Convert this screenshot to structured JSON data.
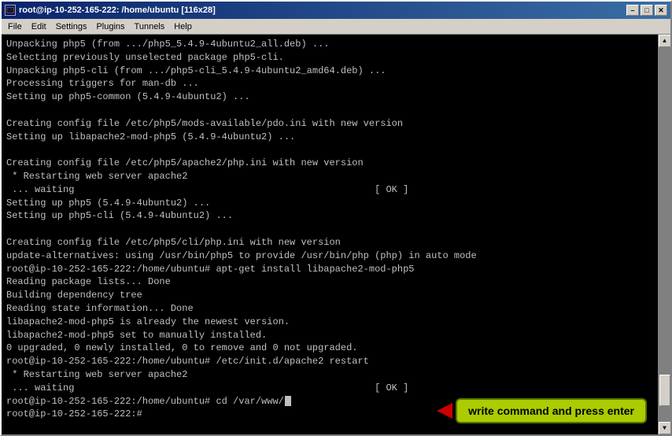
{
  "window": {
    "title": "root@ip-10-252-165-222: /home/ubuntu [116x28]",
    "min_label": "–",
    "max_label": "□",
    "close_label": "✕"
  },
  "menu": {
    "items": [
      "File",
      "Edit",
      "Settings",
      "Plugins",
      "Tunnels",
      "Help"
    ]
  },
  "terminal": {
    "lines": [
      "Unpacking php5 (from .../php5_5.4.9-4ubuntu2_all.deb) ...",
      "Selecting previously unselected package php5-cli.",
      "Unpacking php5-cli (from .../php5-cli_5.4.9-4ubuntu2_amd64.deb) ...",
      "Processing triggers for man-db ...",
      "Setting up php5-common (5.4.9-4ubuntu2) ...",
      "",
      "Creating config file /etc/php5/mods-available/pdo.ini with new version",
      "Setting up libapache2-mod-php5 (5.4.9-4ubuntu2) ...",
      "",
      "Creating config file /etc/php5/apache2/php.ini with new version",
      " * Restarting web server apache2",
      " ... waiting                                                     [ OK ]",
      "Setting up php5 (5.4.9-4ubuntu2) ...",
      "Setting up php5-cli (5.4.9-4ubuntu2) ...",
      "",
      "Creating config file /etc/php5/cli/php.ini with new version",
      "update-alternatives: using /usr/bin/php5 to provide /usr/bin/php (php) in auto mode",
      "root@ip-10-252-165-222:/home/ubuntu# apt-get install libapache2-mod-php5",
      "Reading package lists... Done",
      "Building dependency tree",
      "Reading state information... Done",
      "libapache2-mod-php5 is already the newest version.",
      "libapache2-mod-php5 set to manually installed.",
      "0 upgraded, 0 newly installed, 0 to remove and 0 not upgraded.",
      "root@ip-10-252-165-222:/home/ubuntu# /etc/init.d/apache2 restart",
      " * Restarting web server apache2",
      " ... waiting                                                     [ OK ]",
      "root@ip-10-252-165-222:/home/ubuntu# cd /var/www/"
    ],
    "last_line_prompt": "root@ip-10-252-165-222:/home/ubuntu# ",
    "last_line_cmd": "cd /var/www/",
    "next_prompt": "root@ip-10-252-165-222:#"
  },
  "annotation": {
    "text": "write command and press enter"
  }
}
